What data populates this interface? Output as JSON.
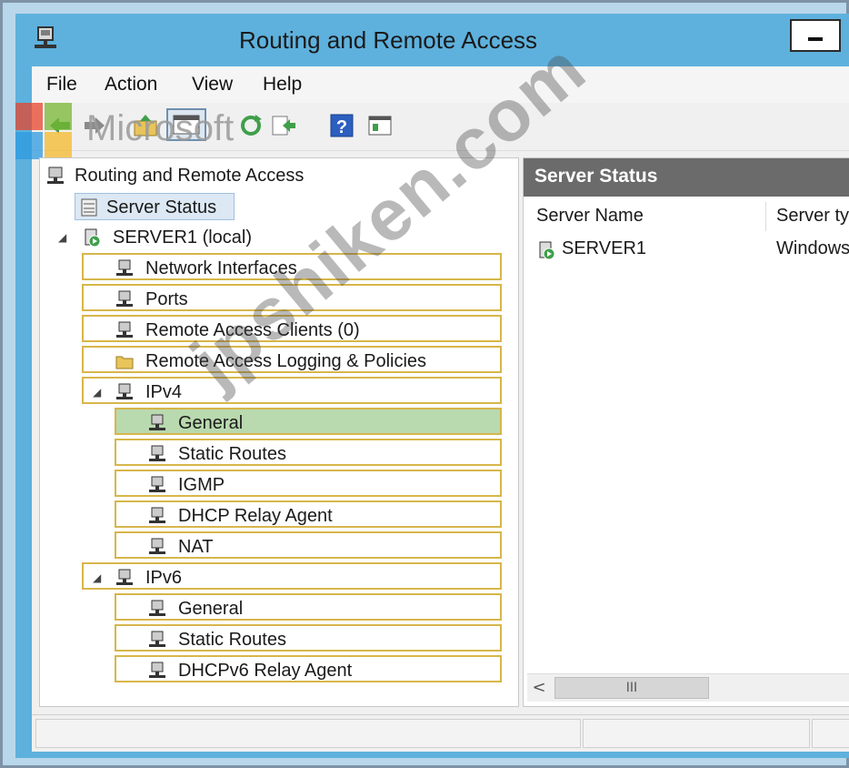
{
  "window": {
    "title": "Routing and Remote Access"
  },
  "menu": {
    "items": [
      "File",
      "Action",
      "View",
      "Help"
    ]
  },
  "toolbar": {
    "icons": [
      "back-arrow-icon",
      "forward-arrow-icon",
      "up-folder-icon",
      "show-hide-console-tree-icon",
      "refresh-icon",
      "export-list-icon",
      "help-icon",
      "properties-icon"
    ]
  },
  "watermark_logo": "Microsoft",
  "watermark_text": "jpshiken.com",
  "tree": {
    "root": "Routing and Remote Access",
    "server_status": "Server Status",
    "server": "SERVER1 (local)",
    "items": {
      "network_interfaces": "Network Interfaces",
      "ports": "Ports",
      "remote_access_clients": "Remote Access Clients (0)",
      "logging_policies": "Remote Access Logging & Policies",
      "ipv4": "IPv4",
      "ipv4_general": "General",
      "ipv4_static_routes": "Static Routes",
      "ipv4_igmp": "IGMP",
      "ipv4_dhcp_relay": "DHCP Relay Agent",
      "ipv4_nat": "NAT",
      "ipv6": "IPv6",
      "ipv6_general": "General",
      "ipv6_static_routes": "Static Routes",
      "ipv6_dhcp_relay": "DHCPv6 Relay Agent"
    }
  },
  "details": {
    "title": "Server Status",
    "columns": [
      "Server Name",
      "Server ty"
    ],
    "rows": [
      {
        "name": "SERVER1",
        "type": "Windows"
      }
    ],
    "scroll_thumb": "III",
    "scroll_left": "<"
  }
}
